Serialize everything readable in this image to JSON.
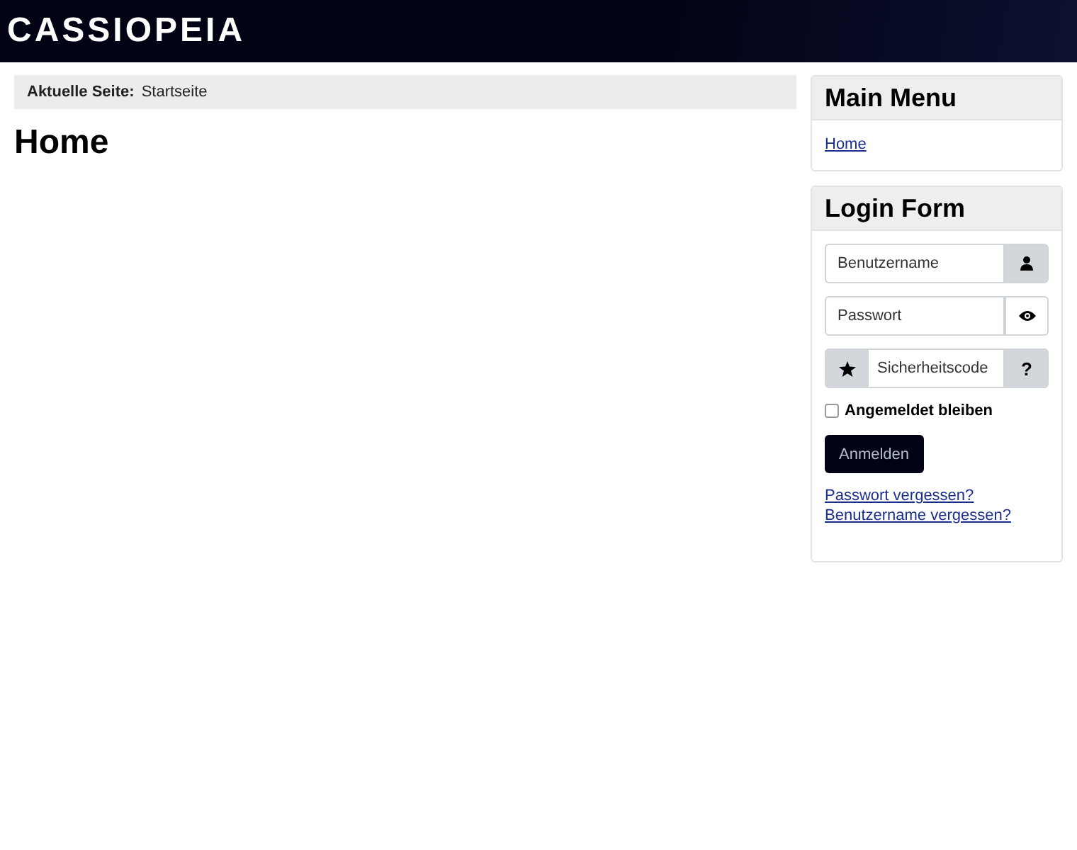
{
  "header": {
    "brand": "CASSIOPEIA"
  },
  "breadcrumb": {
    "label": "Aktuelle Seite:",
    "current": "Startseite"
  },
  "page": {
    "title": "Home"
  },
  "main_menu": {
    "title": "Main Menu",
    "items": [
      {
        "label": "Home"
      }
    ]
  },
  "login_form": {
    "title": "Login Form",
    "username": {
      "placeholder": "Benutzername"
    },
    "password": {
      "placeholder": "Passwort"
    },
    "security_code": {
      "placeholder": "Sicherheitscode",
      "help": "?"
    },
    "remember": {
      "label": "Angemeldet bleiben",
      "checked": false
    },
    "submit": "Anmelden",
    "links": [
      {
        "label": "Passwort vergessen?"
      },
      {
        "label": "Benutzername vergessen?"
      }
    ]
  }
}
